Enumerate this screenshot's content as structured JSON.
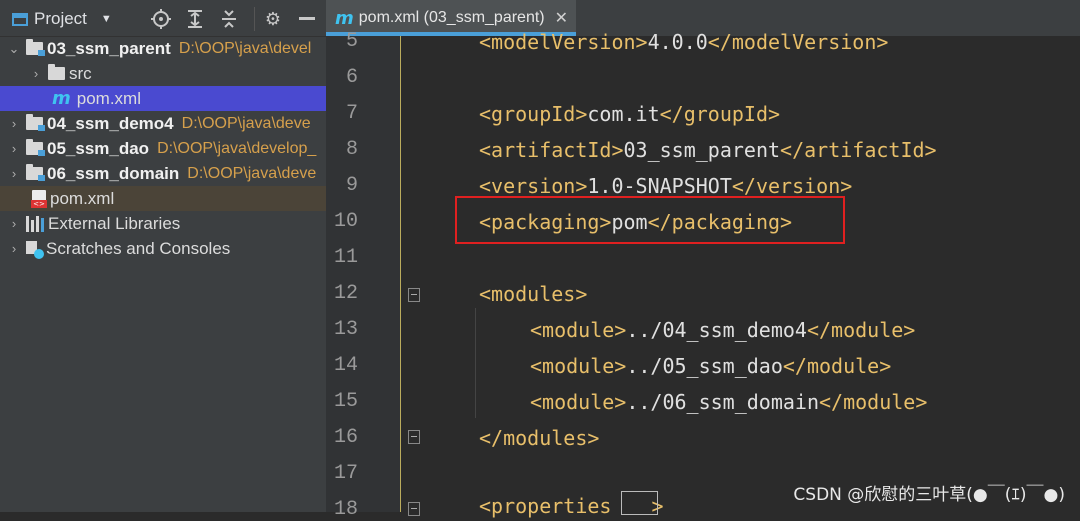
{
  "project_panel": {
    "title": "Project",
    "tree": [
      {
        "name": "03_ssm_parent",
        "path": "D:\\OOP\\java\\devel",
        "expanded": true
      },
      {
        "name": "src"
      },
      {
        "name": "pom.xml"
      },
      {
        "name": "04_ssm_demo4",
        "path": "D:\\OOP\\java\\deve"
      },
      {
        "name": "05_ssm_dao",
        "path": "D:\\OOP\\java\\develop_"
      },
      {
        "name": "06_ssm_domain",
        "path": "D:\\OOP\\java\\deve"
      },
      {
        "name": "pom.xml"
      },
      {
        "name": "External Libraries"
      },
      {
        "name": "Scratches and Consoles"
      }
    ]
  },
  "editor": {
    "tab": {
      "label": "pom.xml (03_ssm_parent)",
      "close": "✕",
      "icon": "m"
    },
    "line_numbers": [
      "5",
      "6",
      "7",
      "8",
      "9",
      "10",
      "11",
      "12",
      "13",
      "14",
      "15",
      "16",
      "17",
      "18"
    ],
    "lines": {
      "l5": {
        "open": "<modelVersion>",
        "text": "4.0.0",
        "close": "</modelVersion>"
      },
      "l7": {
        "open": "<groupId>",
        "text": "com.it",
        "close": "</groupId>"
      },
      "l8": {
        "open": "<artifactId>",
        "text": "03_ssm_parent",
        "close": "</artifactId>"
      },
      "l9": {
        "open": "<version>",
        "text": "1.0-SNAPSHOT",
        "close": "</version>"
      },
      "l10": {
        "open": "<packaging>",
        "text": "pom",
        "close": "</packaging>"
      },
      "l12": {
        "open": "<modules>"
      },
      "l13": {
        "open": "<module>",
        "text": "../04_ssm_demo4",
        "close": "</module>"
      },
      "l14": {
        "open": "<module>",
        "text": "../05_ssm_dao",
        "close": "</module>"
      },
      "l15": {
        "open": "<module>",
        "text": "../06_ssm_domain",
        "close": "</module>"
      },
      "l16": {
        "close": "</modules>"
      },
      "l18": {
        "open": "<properties",
        "close": ">"
      }
    }
  },
  "watermark": "CSDN @欣慰的三叶草(●￣(ｴ)￣●)",
  "colors": {
    "accent": "#4a9fd8",
    "tag": "#e8bf6a",
    "path": "#d6a04c",
    "selection": "#4a4ad0",
    "highlight_box": "#e02020"
  }
}
